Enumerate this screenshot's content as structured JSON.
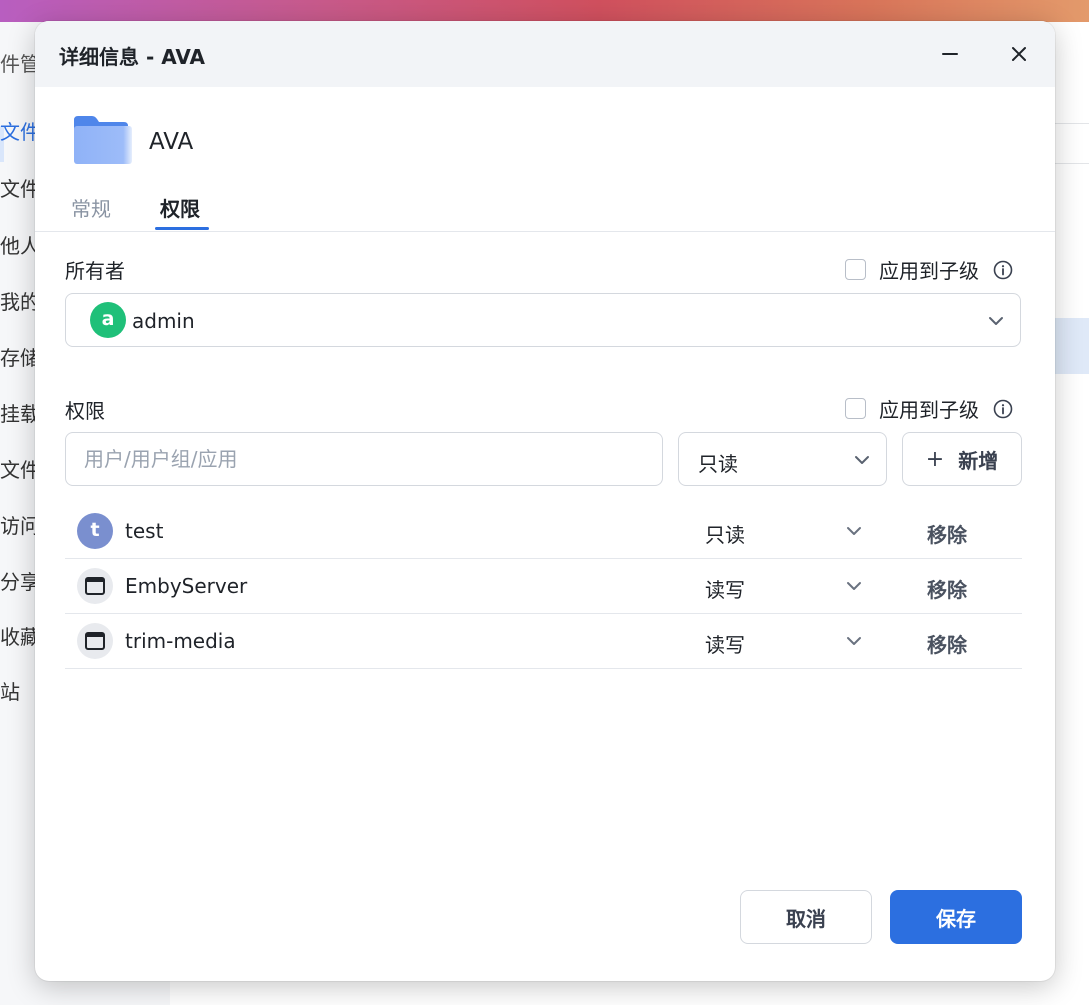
{
  "background": {
    "sidebar_title": "件管",
    "sidebar_items": [
      "文件",
      "文件",
      "他人",
      "我的",
      "存储",
      "挂载",
      "文件",
      "访问",
      "分享",
      "收藏",
      "站"
    ]
  },
  "dialog": {
    "title": "详细信息 - AVA",
    "folder_name": "AVA",
    "tabs": [
      {
        "label": "常规",
        "active": false
      },
      {
        "label": "权限",
        "active": true
      }
    ],
    "owner": {
      "label": "所有者",
      "apply_children": "应用到子级",
      "avatar_letter": "a",
      "value": "admin"
    },
    "permissions": {
      "label": "权限",
      "apply_children": "应用到子级",
      "search_placeholder": "用户/用户组/应用",
      "selected_permission": "只读",
      "add_label": "新增",
      "rows": [
        {
          "name": "test",
          "type": "user",
          "avatar_letter": "t",
          "permission": "只读",
          "remove_label": "移除"
        },
        {
          "name": "EmbyServer",
          "type": "app",
          "permission": "读写",
          "remove_label": "移除"
        },
        {
          "name": "trim-media",
          "type": "app",
          "permission": "读写",
          "remove_label": "移除"
        }
      ]
    },
    "footer": {
      "cancel_label": "取消",
      "save_label": "保存"
    }
  },
  "colors": {
    "accent": "#2c6fe0",
    "owner_avatar": "#1fc079",
    "user_avatar": "#7a8fcf"
  }
}
